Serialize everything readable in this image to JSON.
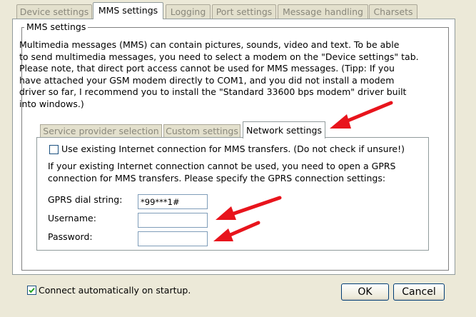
{
  "tabs": [
    {
      "label": "Device settings"
    },
    {
      "label": "MMS settings"
    },
    {
      "label": "Logging"
    },
    {
      "label": "Port settings"
    },
    {
      "label": "Message handling"
    },
    {
      "label": "Charsets"
    }
  ],
  "mms_group": {
    "legend": "MMS settings",
    "description_lines": [
      "Multimedia messages (MMS) can contain pictures, sounds, video and text. To be able",
      "to send multimedia messages, you need to select a modem on the \"Device settings\" tab.",
      "Please note, that direct port access cannot be used for MMS messages. (Tipp: If you",
      "have attached your GSM modem directly to COM1, and you did not install a modem",
      "driver so far, I recommend you to install the \"Standard 33600 bps modem\" driver built",
      "into windows.)"
    ]
  },
  "inner_tabs": [
    {
      "label": "Service provider selection"
    },
    {
      "label": "Custom settings"
    },
    {
      "label": "Network settings"
    }
  ],
  "network": {
    "use_existing_label": "Use existing Internet connection for MMS transfers. (Do not check if unsure!)",
    "use_existing_checked": false,
    "info_lines": [
      "If your existing Internet connection cannot be used,  you need to open a GPRS",
      "connection for MMS transfers. Please specify the GPRS connection settings:"
    ],
    "dial_label": "GPRS dial string:",
    "dial_value": "*99***1#",
    "username_label": "Username:",
    "username_value": "",
    "password_label": "Password:",
    "password_value": ""
  },
  "footer": {
    "connect_label": "Connect automatically on startup.",
    "connect_checked": true,
    "ok_label": "OK",
    "cancel_label": "Cancel"
  },
  "colors": {
    "window_bg": "#ece9d8",
    "arrow": "#e8141c",
    "checkbox_border": "#1c5180",
    "check_mark": "#21a121"
  }
}
